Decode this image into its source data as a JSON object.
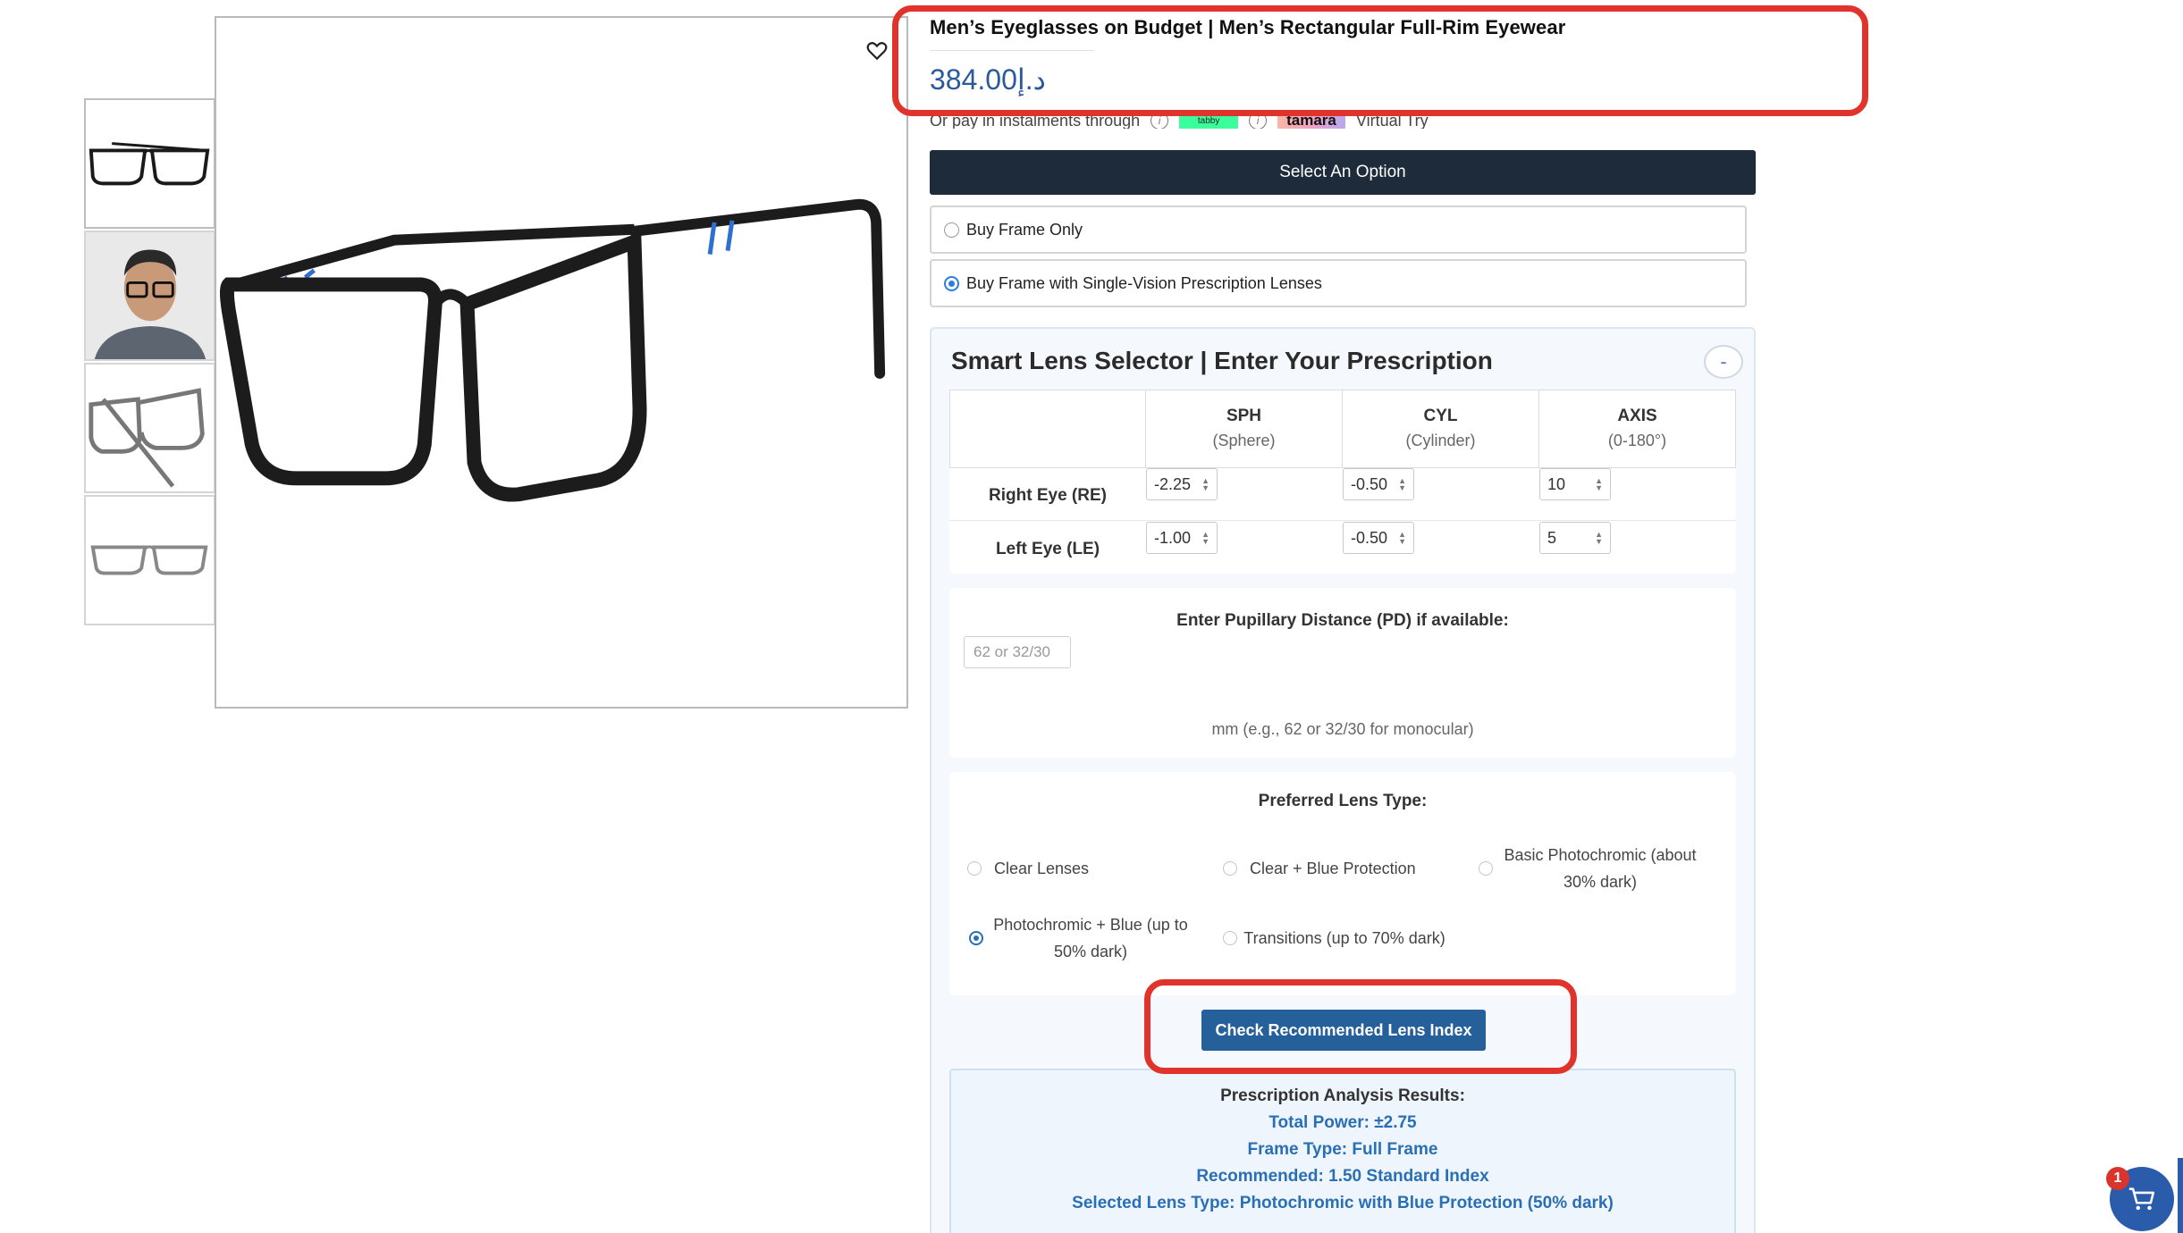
{
  "product": {
    "title": "Men’s Eyeglasses on Budget | Men’s Rectangular Full-Rim Eyewear",
    "price": "384.00د.إ",
    "installments_text": "Or pay in instalments through",
    "virtual_try": "Virtual Try",
    "tamara_label": "tamara",
    "thumbnails": [
      "front-view",
      "model-view",
      "side-view",
      "top-view"
    ]
  },
  "options": {
    "select_label": "Select An Option",
    "items": [
      {
        "label": "Buy Frame Only",
        "checked": false
      },
      {
        "label": "Buy Frame with Single-Vision Prescription Lenses",
        "checked": true
      }
    ]
  },
  "lens_selector": {
    "title": "Smart Lens Selector | Enter Your Prescription",
    "collapse_label": "-",
    "columns": [
      {
        "name": "SPH",
        "sub": "(Sphere)"
      },
      {
        "name": "CYL",
        "sub": "(Cylinder)"
      },
      {
        "name": "AXIS",
        "sub": "(0-180°)"
      }
    ],
    "rows": [
      {
        "label": "Right Eye (RE)",
        "sph": "-2.25",
        "cyl": "-0.50",
        "axis": "10"
      },
      {
        "label": "Left Eye (LE)",
        "sph": "-1.00",
        "cyl": "-0.50",
        "axis": "5"
      }
    ],
    "pd": {
      "label": "Enter Pupillary Distance (PD) if available:",
      "placeholder": "62 or 32/30",
      "hint": "mm (e.g., 62 or 32/30 for monocular)"
    },
    "lens_type": {
      "label": "Preferred Lens Type:",
      "options": [
        {
          "label": "Clear Lenses",
          "checked": false
        },
        {
          "label": "Clear + Blue Protection",
          "checked": false
        },
        {
          "label": "Basic Photochromic (about 30% dark)",
          "checked": false
        },
        {
          "label": "Photochromic + Blue (up to 50% dark)",
          "checked": true
        },
        {
          "label": "Transitions (up to 70% dark)",
          "checked": false
        }
      ]
    },
    "check_button": "Check Recommended Lens Index",
    "results": {
      "heading": "Prescription Analysis Results:",
      "total_power": "Total Power: ±2.75",
      "frame_type": "Frame Type: Full Frame",
      "recommended": "Recommended: 1.50 Standard Index",
      "selected": "Selected Lens Type: Photochromic with Blue Protection (50% dark)"
    }
  },
  "cart": {
    "count": "1"
  },
  "colors": {
    "accent": "#2a5cab",
    "highlight": "#e0332c",
    "dark_bar": "#1d2b3a",
    "price": "#2b5a99"
  }
}
